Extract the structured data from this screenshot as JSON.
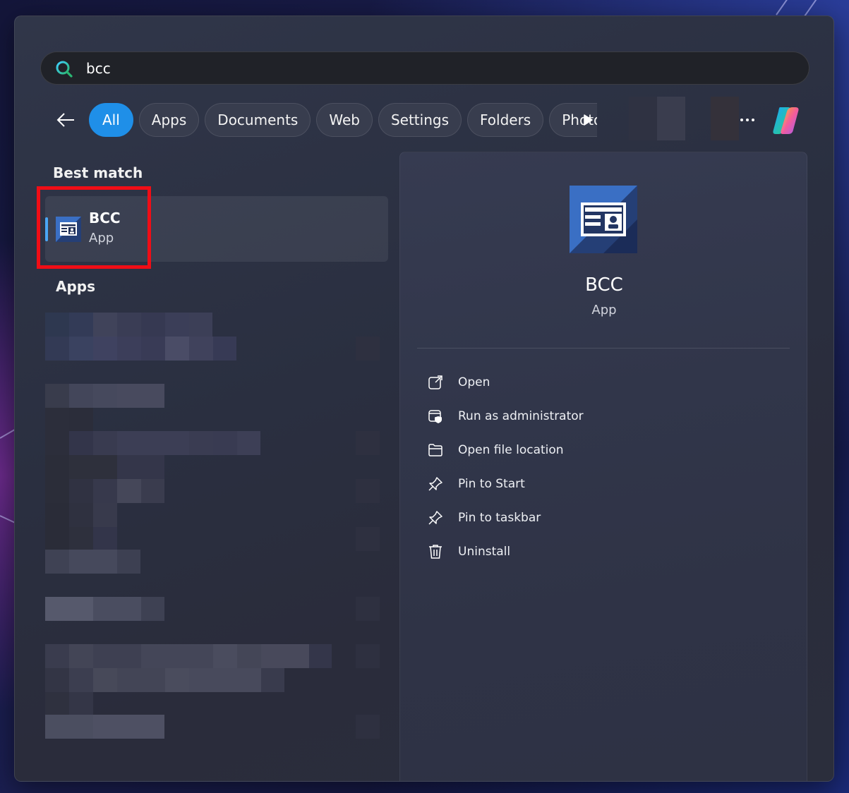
{
  "search": {
    "query": "bcc",
    "icon": "search-icon"
  },
  "filters": {
    "back_icon": "back-arrow-icon",
    "chips": [
      {
        "label": "All",
        "active": true
      },
      {
        "label": "Apps",
        "active": false
      },
      {
        "label": "Documents",
        "active": false
      },
      {
        "label": "Web",
        "active": false
      },
      {
        "label": "Settings",
        "active": false
      },
      {
        "label": "Folders",
        "active": false
      },
      {
        "label": "Photos",
        "active": false
      }
    ],
    "scroll_icon": "play-icon",
    "more_icon": "more-icon",
    "copilot_icon": "copilot-icon"
  },
  "results": {
    "best_match_title": "Best match",
    "best_match": {
      "name": "BCC",
      "type": "App",
      "icon": "app-id-card-icon"
    },
    "apps_title": "Apps"
  },
  "details": {
    "name": "BCC",
    "type": "App",
    "icon": "app-id-card-icon",
    "actions": [
      {
        "label": "Open",
        "icon": "open-external-icon"
      },
      {
        "label": "Run as administrator",
        "icon": "shield-run-icon"
      },
      {
        "label": "Open file location",
        "icon": "folder-icon"
      },
      {
        "label": "Pin to Start",
        "icon": "pin-icon"
      },
      {
        "label": "Pin to taskbar",
        "icon": "pin-icon"
      },
      {
        "label": "Uninstall",
        "icon": "trash-icon"
      }
    ]
  },
  "colors": {
    "accent": "#1f8fe8",
    "highlight": "#f00d16",
    "panel": "#2c3040"
  }
}
